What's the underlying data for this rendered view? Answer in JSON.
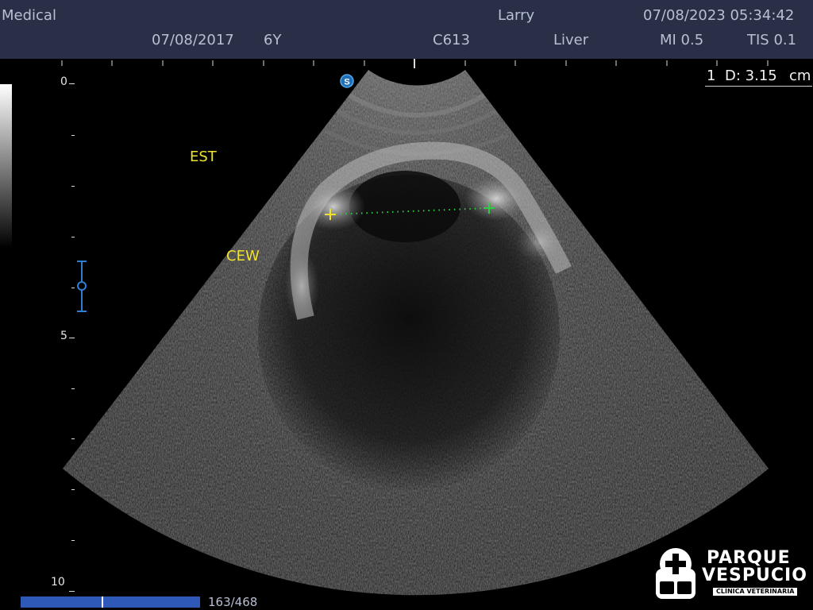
{
  "header": {
    "institution": "Medical",
    "patient_name": "Larry",
    "exam_datetime": "07/08/2023 05:34:42",
    "birth_date": "07/08/2017",
    "age": "6Y",
    "probe": "C613",
    "preset": "Liver",
    "mi": "MI 0.5",
    "tis": "TIS 0.1"
  },
  "measurement": {
    "index": "1",
    "distance_label": "D: 3.15",
    "unit": "cm"
  },
  "depth_scale": {
    "labels": [
      "0",
      "5",
      "10"
    ]
  },
  "annotations": {
    "est": "EST",
    "cew": "CEW"
  },
  "cine": {
    "frame_counter": "163/468"
  },
  "probe_mark": {
    "letter": "S"
  },
  "logo": {
    "line1": "PARQUE",
    "line2": "VESPUCIO",
    "line3": "CLÍNICA VETERINARIA"
  },
  "colors": {
    "header_bg": "#282f47",
    "header_text": "#b9bfd3",
    "annotation": "#f0e22a",
    "caliper_start": "#f0e22a",
    "caliper_end": "#2ecc40",
    "focus_marker": "#2f7fd1",
    "cine_bar": "#2f59b9"
  }
}
